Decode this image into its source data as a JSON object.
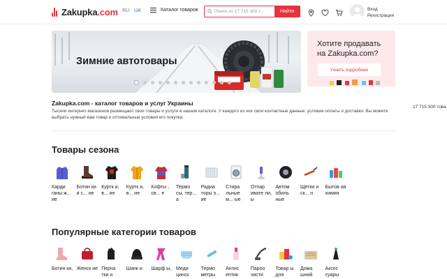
{
  "header": {
    "logo": "Zakupka",
    "logo_domain": ".com",
    "lang_ru": "RU",
    "lang_ua": "UA",
    "catalog_label": "Каталог товаров",
    "search_placeholder": "Поиск по 17 715 300 т...",
    "search_button": "Найти",
    "login": "Вход",
    "register": "Регистрация"
  },
  "banner": {
    "title": "Зимние автотовары",
    "slide_count": 13,
    "active_slide": 1
  },
  "sell_card": {
    "title_line1": "Хотите продавать",
    "title_line2": "на Zakupka.com?",
    "button": "Узнать подробнее"
  },
  "about": {
    "title": "Zakupka.com - каталог товаров и услуг Украины",
    "text": "Тысячи интернет-магазинов размещают свои товары и услуги в нашем каталоге. У каждого из них свои контактные данные, условия оплаты и доставки. Вы можете выбрать нужный вам товар и оптимальные условия его покупки.",
    "count": "17 715 300 това"
  },
  "season": {
    "title": "Товары сезона",
    "items": [
      {
        "label": "Карди ганы ж... ие",
        "icon": "cardigan"
      },
      {
        "label": "Ботин ки и с... ие",
        "icon": "boot"
      },
      {
        "label": "Куртк и, в... ие",
        "icon": "jacket-red"
      },
      {
        "label": "Куртк и, в... ие",
        "icon": "jacket-yellow"
      },
      {
        "label": "Кофты , св... е",
        "icon": "sweater"
      },
      {
        "label": "Термо сы, тер... а",
        "icon": "thermos"
      },
      {
        "label": "Радиа торы э... ие",
        "icon": "radiator"
      },
      {
        "label": "Стира льные м... ые",
        "icon": "washer"
      },
      {
        "label": "Отпар ивате ли, ы",
        "icon": "steamer"
      },
      {
        "label": "Автом обиль ные",
        "icon": "tire"
      },
      {
        "label": "Щетки и ск... н",
        "icon": "brush"
      },
      {
        "label": "Бытов ая химия",
        "icon": "chemistry"
      }
    ]
  },
  "popular": {
    "title": "Популярные категории товаров",
    "items": [
      {
        "label": "Ботин ки,",
        "icon": "pink-boot"
      },
      {
        "label": "Женск ие",
        "icon": "handbag"
      },
      {
        "label": "Перча тки и",
        "icon": "gloves"
      },
      {
        "label": "Шапк и",
        "icon": "hat"
      },
      {
        "label": "Шарф ы,",
        "icon": "scarf"
      },
      {
        "label": "Меди цинск",
        "icon": "mask"
      },
      {
        "label": "Термо метры",
        "icon": "thermometer"
      },
      {
        "label": "Антис ептик",
        "icon": "antiseptic"
      },
      {
        "label": "Пароо чисти",
        "icon": "steam-cleaner"
      },
      {
        "label": "Товар ы для",
        "icon": "toys"
      },
      {
        "label": "Дома шний",
        "icon": "home"
      },
      {
        "label": "Аксес суары",
        "icon": "accessories"
      }
    ]
  },
  "colors": {
    "accent": "#e8323c",
    "link": "#2a6fd6",
    "sell_bg": "#fde9ec"
  }
}
